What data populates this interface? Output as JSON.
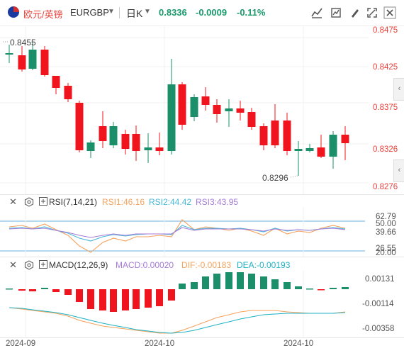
{
  "header": {
    "pair_name": "欧元/英镑",
    "symbol": "EURGBP",
    "timeframe": "日K",
    "price": "0.8336",
    "change": "-0.0009",
    "change_pct": "-0.11%"
  },
  "toolbar_icons": [
    "chart-type-icon",
    "indicator-icon",
    "draw-icon",
    "fullscreen-icon",
    "close-icon"
  ],
  "main_chart": {
    "price_labels": [
      "0.8475",
      "0.8425",
      "0.8375",
      "0.8326",
      "0.8276"
    ],
    "high_annotation": "0.8455",
    "low_annotation": "0.8296",
    "up_color": "#1a8f6a",
    "down_color": "#f0141e"
  },
  "rsi": {
    "title": "RSI(7,14,21)",
    "rsi1": "RSI1:46.16",
    "rsi2": "RSI2:44.42",
    "rsi3": "RSI3:43.95",
    "axis_labels": [
      "62.79",
      "50.00",
      "39.66",
      "26.55",
      "20.00"
    ],
    "colors": {
      "rsi1": "#f4a25d",
      "rsi2": "#4ab8d8",
      "rsi3": "#a57bd6"
    }
  },
  "macd": {
    "title": "MACD(12,26,9)",
    "macd": "MACD:0.00020",
    "dif": "DIF:-0.00183",
    "dea": "DEA:-0.00193",
    "axis_labels": [
      "0.00131",
      "-0.00114",
      "-0.00358"
    ],
    "colors": {
      "macd": "#a57bd6",
      "dif": "#f4a25d",
      "dea": "#1fb3c4"
    }
  },
  "x_axis": [
    "2024-09",
    "2024-10",
    "2024-10"
  ]
}
